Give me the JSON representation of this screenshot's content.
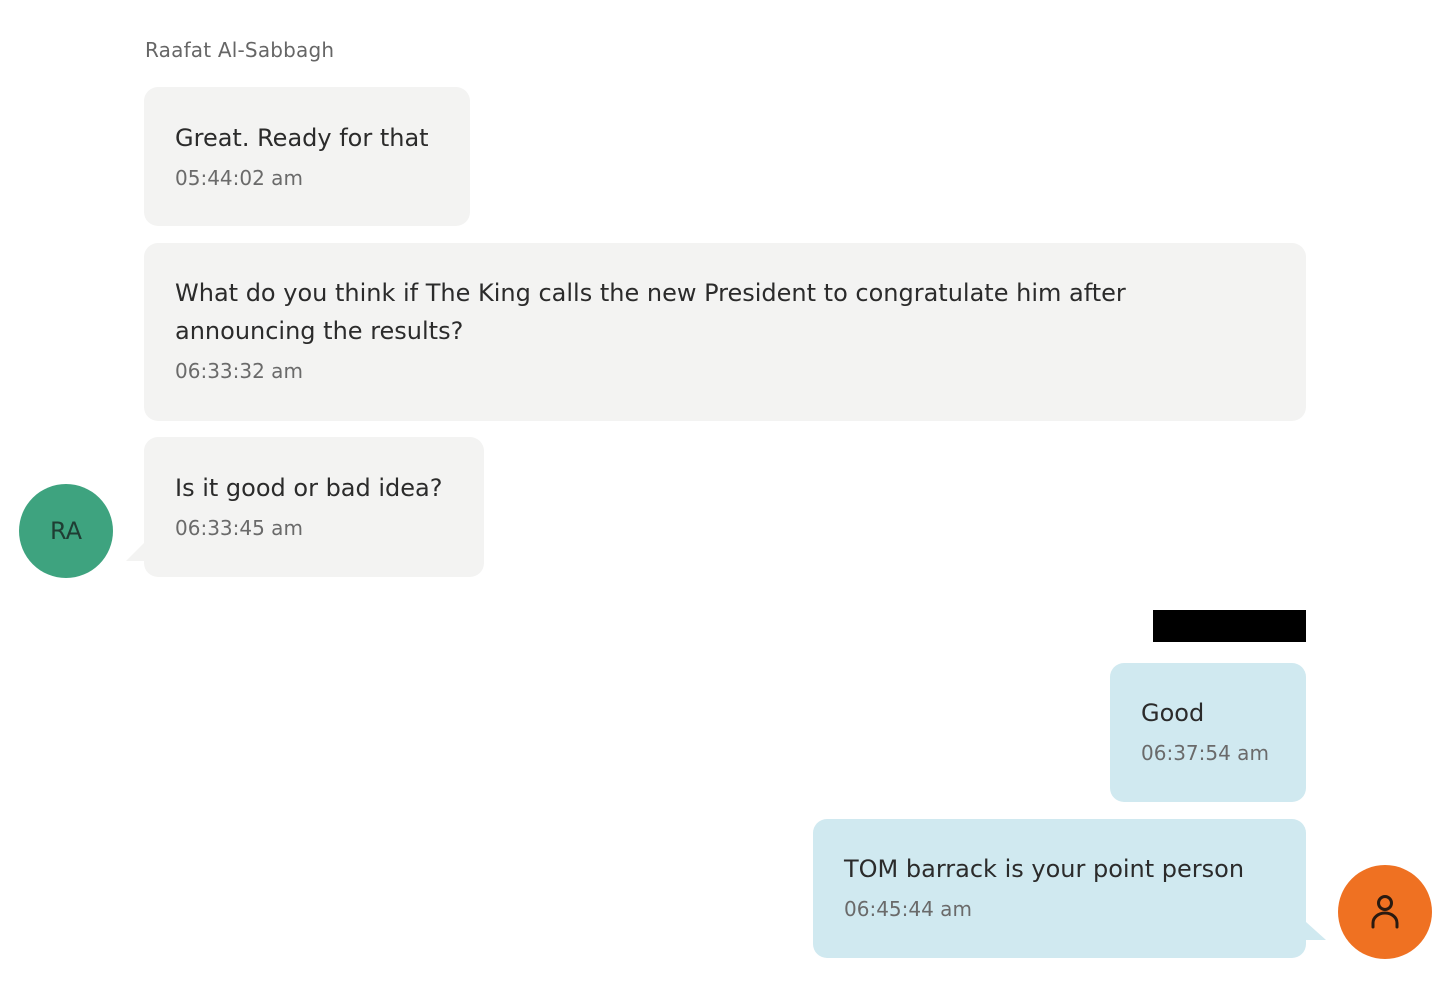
{
  "conversation": {
    "contact_name": "Raafat Al-Sabbagh",
    "contact_initials": "RA",
    "user_avatar_icon": "person-icon"
  },
  "messages": [
    {
      "direction": "incoming",
      "text": "Great. Ready for that",
      "time": "05:44:02 am"
    },
    {
      "direction": "incoming",
      "text": "What do you think if The King calls the new President to congratulate him after announcing the results?",
      "time": "06:33:32 am"
    },
    {
      "direction": "incoming",
      "text": "Is it good or bad idea?",
      "time": "06:33:45 am"
    },
    {
      "direction": "outgoing",
      "text": "Good",
      "time": "06:37:54 am"
    },
    {
      "direction": "outgoing",
      "text": "TOM barrack is your point person",
      "time": "06:45:44 am"
    }
  ],
  "colors": {
    "incoming_bubble": "#f3f3f2",
    "outgoing_bubble": "#d0e9f0",
    "contact_avatar": "#3ea37f",
    "user_avatar": "#ef7122",
    "redaction": "#000000"
  }
}
